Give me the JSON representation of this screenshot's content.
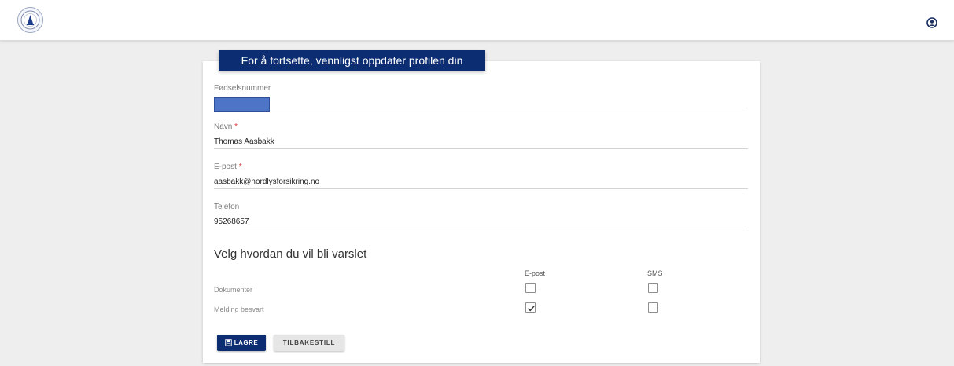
{
  "header": {
    "logo_icon": "company-logo-icon",
    "user_icon": "user-profile-icon"
  },
  "banner": {
    "text": "For å fortsette, vennligst oppdater profilen din"
  },
  "form": {
    "fields": [
      {
        "label": "Fødselsnummer",
        "value": "",
        "required": false
      },
      {
        "label": "Navn",
        "value": "Thomas Aasbakk",
        "required": true
      },
      {
        "label": "E-post",
        "value": "aasbakk@nordlysforsikring.no",
        "required": true
      },
      {
        "label": "Telefon",
        "value": "95268657",
        "required": false
      }
    ],
    "required_marker": "*"
  },
  "notifications": {
    "title": "Velg hvordan du vil bli varslet",
    "columns": [
      "E-post",
      "SMS"
    ],
    "rows": [
      {
        "label": "Dokumenter",
        "epost": false,
        "sms": false
      },
      {
        "label": "Melding besvart",
        "epost": true,
        "sms": false
      }
    ]
  },
  "buttons": {
    "save_label": "LAGRE",
    "save_icon": "save-icon",
    "reset_label": "TILBAKESTILL"
  },
  "colors": {
    "primary": "#0c2d72",
    "masked": "#4e74c8",
    "required": "#d23c3c"
  }
}
